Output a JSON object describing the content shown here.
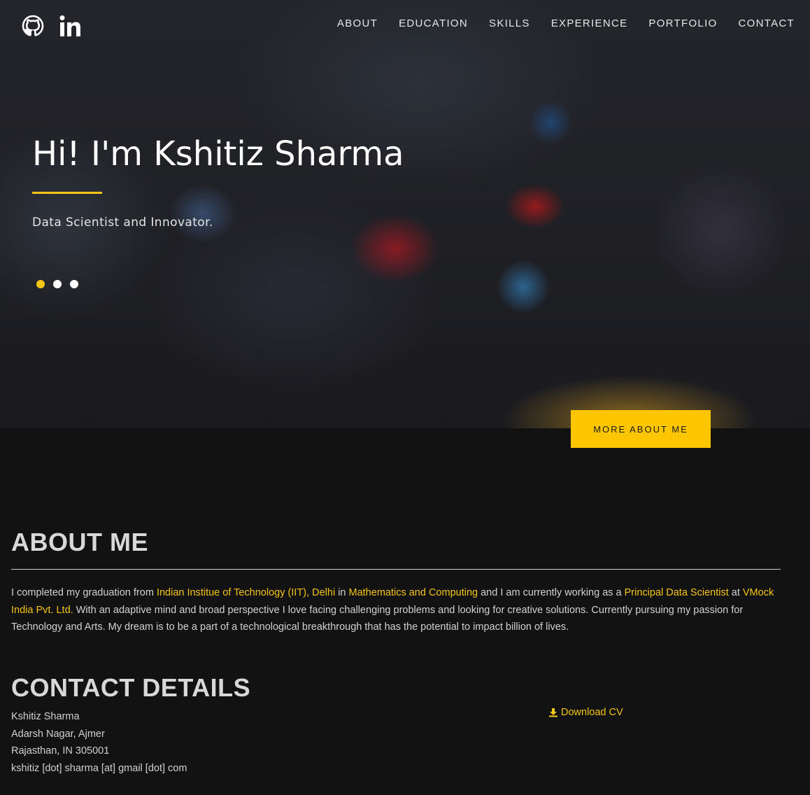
{
  "nav": {
    "items": [
      "ABOUT",
      "EDUCATION",
      "SKILLS",
      "EXPERIENCE",
      "PORTFOLIO",
      "CONTACT"
    ],
    "social_icons": [
      "github-icon",
      "linkedin-icon"
    ]
  },
  "hero": {
    "title": "Hi! I'm Kshitiz Sharma",
    "subtitle": "Data Scientist and Innovator.",
    "slide_count": 3,
    "active_slide": 1,
    "button_label": "MORE ABOUT ME"
  },
  "about": {
    "title": "ABOUT ME",
    "p1": "I completed my graduation from ",
    "institute": "Indian Institue of Technology (IIT), Delhi",
    "p2": " in ",
    "degree": "Mathematics and Computing",
    "p3": " and I am currently working as a ",
    "role": "Principal Data Scientist",
    "p4": " at ",
    "company": "VMock India Pvt. Ltd.",
    "p5": " With an adaptive mind and broad perspective I love facing challenging problems and looking for creative solutions. Currently pursuing my passion for Technology and Arts. My dream is to be a part of a technological breakthrough that has the potential to impact billion of lives."
  },
  "contact": {
    "title": "CONTACT DETAILS",
    "name": "Kshitiz Sharma",
    "address1": "Adarsh Nagar, Ajmer",
    "address2": "Rajasthan, IN 305001",
    "email": "kshitiz [dot] sharma [at] gmail [dot] com",
    "download_label": "Download CV",
    "download_icon": "download-icon"
  },
  "colors": {
    "accent": "#f5c518",
    "button": "#fec600",
    "background": "#121212"
  }
}
